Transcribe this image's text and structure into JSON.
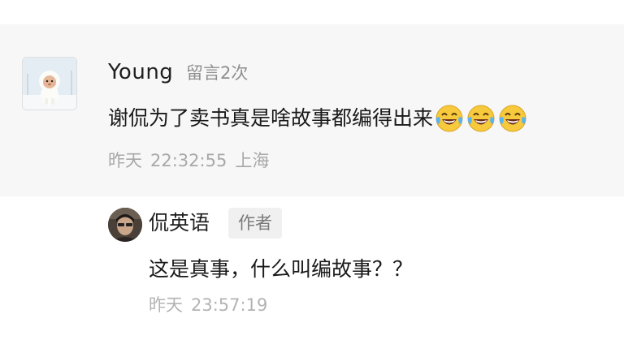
{
  "comment": {
    "username": "Young",
    "message_count": "留言2次",
    "text": "谢侃为了卖书真是啥故事都编得出来",
    "emojis": [
      "laughing-with-tears-emoji",
      "laughing-with-tears-emoji",
      "laughing-with-tears-emoji"
    ],
    "date": "昨天",
    "time": "22:32:55",
    "location": "上海"
  },
  "reply": {
    "author": "侃英语",
    "badge": "作者",
    "text": "这是真事，什么叫编故事？？",
    "date": "昨天",
    "time": "23:57:19"
  },
  "colors": {
    "comment_background": "#f7f7f7",
    "secondary_text": "#a8a8a8",
    "badge_background": "#f0f0f0"
  }
}
